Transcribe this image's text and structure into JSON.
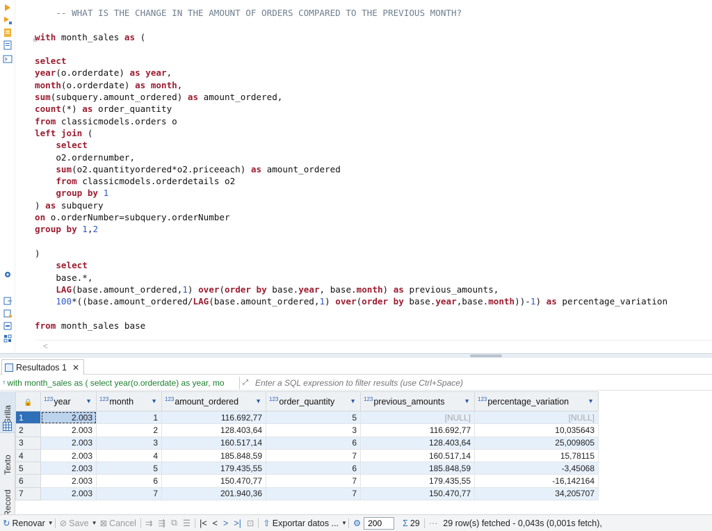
{
  "editor": {
    "lines": [
      [
        {
          "c": "cm",
          "t": "    -- WHAT IS THE CHANGE IN THE AMOUNT OF ORDERS COMPARED TO THE PREVIOUS MONTH?"
        }
      ],
      [],
      [
        {
          "c": "kw",
          "t": "with"
        },
        {
          "t": " month_sales "
        },
        {
          "c": "kw",
          "t": "as"
        },
        {
          "t": " ("
        }
      ],
      [],
      [
        {
          "c": "kw",
          "t": "select"
        }
      ],
      [
        {
          "c": "kw",
          "t": "year"
        },
        {
          "t": "(o.orderdate) "
        },
        {
          "c": "kw",
          "t": "as"
        },
        {
          "t": " "
        },
        {
          "c": "kw",
          "t": "year"
        },
        {
          "t": ","
        }
      ],
      [
        {
          "c": "kw",
          "t": "month"
        },
        {
          "t": "(o.orderdate) "
        },
        {
          "c": "kw",
          "t": "as"
        },
        {
          "t": " "
        },
        {
          "c": "kw",
          "t": "month"
        },
        {
          "t": ","
        }
      ],
      [
        {
          "c": "kw",
          "t": "sum"
        },
        {
          "t": "(subquery.amount_ordered) "
        },
        {
          "c": "kw",
          "t": "as"
        },
        {
          "t": " amount_ordered,"
        }
      ],
      [
        {
          "c": "kw",
          "t": "count"
        },
        {
          "t": "(*) "
        },
        {
          "c": "kw",
          "t": "as"
        },
        {
          "t": " order_quantity"
        }
      ],
      [
        {
          "c": "kw",
          "t": "from"
        },
        {
          "t": " classicmodels.orders o"
        }
      ],
      [
        {
          "c": "kw",
          "t": "left join"
        },
        {
          "t": " ("
        }
      ],
      [
        {
          "t": "    "
        },
        {
          "c": "kw",
          "t": "select"
        }
      ],
      [
        {
          "t": "    o2.ordernumber,"
        }
      ],
      [
        {
          "t": "    "
        },
        {
          "c": "kw",
          "t": "sum"
        },
        {
          "t": "(o2.quantityordered*o2.priceeach) "
        },
        {
          "c": "kw",
          "t": "as"
        },
        {
          "t": " amount_ordered"
        }
      ],
      [
        {
          "t": "    "
        },
        {
          "c": "kw",
          "t": "from"
        },
        {
          "t": " classicmodels.orderdetails o2"
        }
      ],
      [
        {
          "t": "    "
        },
        {
          "c": "kw",
          "t": "group by"
        },
        {
          "t": " "
        },
        {
          "c": "num",
          "t": "1"
        }
      ],
      [
        {
          "t": ") "
        },
        {
          "c": "kw",
          "t": "as"
        },
        {
          "t": " subquery"
        }
      ],
      [
        {
          "c": "kw",
          "t": "on"
        },
        {
          "t": " o.orderNumber=subquery.orderNumber"
        }
      ],
      [
        {
          "c": "kw",
          "t": "group by"
        },
        {
          "t": " "
        },
        {
          "c": "num",
          "t": "1"
        },
        {
          "t": ","
        },
        {
          "c": "num",
          "t": "2"
        }
      ],
      [],
      [
        {
          "t": ")"
        }
      ],
      [
        {
          "t": "    "
        },
        {
          "c": "kw",
          "t": "select"
        }
      ],
      [
        {
          "t": "    base.*,"
        }
      ],
      [
        {
          "t": "    "
        },
        {
          "c": "kw",
          "t": "LAG"
        },
        {
          "t": "(base.amount_ordered,"
        },
        {
          "c": "num",
          "t": "1"
        },
        {
          "t": ") "
        },
        {
          "c": "kw",
          "t": "over"
        },
        {
          "t": "("
        },
        {
          "c": "kw",
          "t": "order by"
        },
        {
          "t": " base."
        },
        {
          "c": "kw",
          "t": "year"
        },
        {
          "t": ", base."
        },
        {
          "c": "kw",
          "t": "month"
        },
        {
          "t": ") "
        },
        {
          "c": "kw",
          "t": "as"
        },
        {
          "t": " previous_amounts,"
        }
      ],
      [
        {
          "t": "    "
        },
        {
          "c": "num",
          "t": "100"
        },
        {
          "t": "*((base.amount_ordered/"
        },
        {
          "c": "kw",
          "t": "LAG"
        },
        {
          "t": "(base.amount_ordered,"
        },
        {
          "c": "num",
          "t": "1"
        },
        {
          "t": ") "
        },
        {
          "c": "kw",
          "t": "over"
        },
        {
          "t": "("
        },
        {
          "c": "kw",
          "t": "order by"
        },
        {
          "t": " base."
        },
        {
          "c": "kw",
          "t": "year"
        },
        {
          "t": ",base."
        },
        {
          "c": "kw",
          "t": "month"
        },
        {
          "t": "))-"
        },
        {
          "c": "num",
          "t": "1"
        },
        {
          "t": ") "
        },
        {
          "c": "kw",
          "t": "as"
        },
        {
          "t": " percentage_variation"
        }
      ],
      [],
      [
        {
          "c": "kw",
          "t": "from"
        },
        {
          "t": " month_sales base"
        }
      ]
    ]
  },
  "results_tab": {
    "label": "Resultados 1"
  },
  "filter": {
    "query_text": "with month_sales as ( select year(o.orderdate) as year, mo",
    "placeholder": "Enter a SQL expression to filter results (use Ctrl+Space)"
  },
  "side_tabs": {
    "grid": "Grilla",
    "text": "Texto",
    "record": "Record"
  },
  "grid": {
    "type_prefix": "123",
    "columns": [
      "year",
      "month",
      "amount_ordered",
      "order_quantity",
      "previous_amounts",
      "percentage_variation"
    ],
    "rows": [
      [
        "1",
        "2.003",
        "1",
        "116.692,77",
        "5",
        "[NULL]",
        "[NULL]"
      ],
      [
        "2",
        "2.003",
        "2",
        "128.403,64",
        "3",
        "116.692,77",
        "10,035643"
      ],
      [
        "3",
        "2.003",
        "3",
        "160.517,14",
        "6",
        "128.403,64",
        "25,009805"
      ],
      [
        "4",
        "2.003",
        "4",
        "185.848,59",
        "7",
        "160.517,14",
        "15,78115"
      ],
      [
        "5",
        "2.003",
        "5",
        "179.435,55",
        "6",
        "185.848,59",
        "-3,45068"
      ],
      [
        "6",
        "2.003",
        "6",
        "150.470,77",
        "7",
        "179.435,55",
        "-16,142164"
      ],
      [
        "7",
        "2.003",
        "7",
        "201.940,36",
        "7",
        "150.470,77",
        "34,205707"
      ]
    ]
  },
  "toolbar": {
    "refresh": "Renovar",
    "save": "Save",
    "cancel": "Cancel",
    "export": "Exportar datos ...",
    "fetch_size": "200",
    "row_count": "29",
    "status": "29 row(s) fetched - 0,043s (0,001s fetch),"
  }
}
